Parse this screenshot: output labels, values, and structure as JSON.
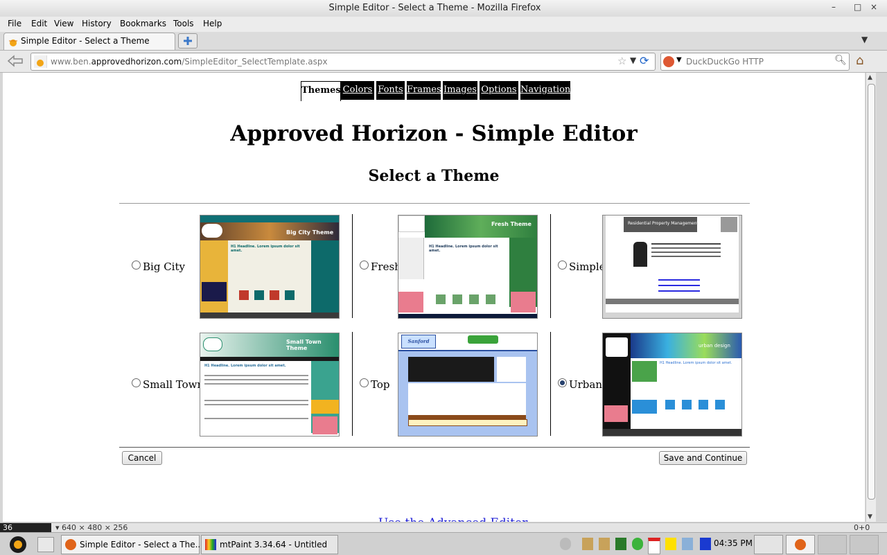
{
  "window": {
    "title": "Simple Editor - Select a Theme - Mozilla Firefox",
    "controls": [
      "–",
      "□",
      "×"
    ]
  },
  "menu": [
    "File",
    "Edit",
    "View",
    "History",
    "Bookmarks",
    "Tools",
    "Help"
  ],
  "tab": {
    "label": "Simple Editor - Select a Theme"
  },
  "address": {
    "prefix": "www.ben.",
    "domain": "approvedhorizon.com",
    "path": "/SimpleEditor_SelectTemplate.aspx"
  },
  "search": {
    "placeholder": "DuckDuckGo HTTP"
  },
  "editor_tabs": [
    "Themes",
    "Colors",
    "Fonts",
    "Frames",
    "Images",
    "Options",
    "Navigation"
  ],
  "heading": "Approved Horizon - Simple Editor",
  "subheading": "Select a Theme",
  "themes": [
    {
      "name": "Big City",
      "selected": false,
      "banner": "Big City Theme",
      "headline": "H1 Headline. Lorem ipsum dolor sit amet."
    },
    {
      "name": "Fresh",
      "selected": false,
      "banner": "Fresh Theme",
      "headline": "H1 Headline. Lorem ipsum dolor sit amet."
    },
    {
      "name": "Simple",
      "selected": false,
      "banner": "Residential Property Management",
      "headline": ""
    },
    {
      "name": "Small Town",
      "selected": false,
      "banner": "Small Town Theme",
      "headline": "H1 Headline. Lorem ipsum dolor sit amet."
    },
    {
      "name": "Top",
      "selected": false,
      "banner": "Sanford",
      "headline": ""
    },
    {
      "name": "Urban",
      "selected": true,
      "banner": "urban design",
      "headline": "H1 Headline. Lorem ipsum dolor sit amet."
    }
  ],
  "buttons": {
    "cancel": "Cancel",
    "save": "Save and Continue"
  },
  "advanced_link": "Use the Advanced Editor",
  "status": {
    "left_num": "36",
    "dims": "▾  640 × 480 × 256",
    "coords": "0+0"
  },
  "taskbar": {
    "items": [
      "Simple Editor - Select a The...",
      "mtPaint 3.34.64 - Untitled"
    ],
    "clock": "04:35 PM"
  },
  "colors": {
    "accent": "#000000",
    "link": "#1d1dd6",
    "radio_checked": "#28426e"
  }
}
